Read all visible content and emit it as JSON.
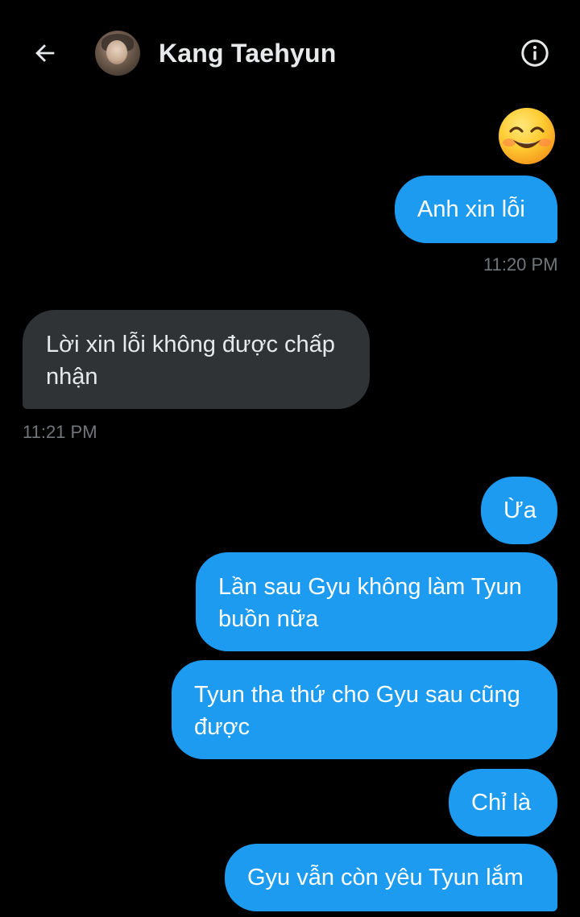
{
  "header": {
    "back_icon": "back-arrow-icon",
    "contact_name": "Kang Taehyun",
    "info_icon": "info-icon"
  },
  "colors": {
    "background": "#000000",
    "outgoing_bubble": "#1d9bf0",
    "incoming_bubble": "#2f3336",
    "timestamp": "#71767b"
  },
  "conversation": {
    "emoji_message": "smiling-face-with-smiling-eyes-emoji",
    "messages": [
      {
        "direction": "outgoing",
        "text": "Anh xin lỗi",
        "timestamp": "11:20 PM"
      },
      {
        "direction": "incoming",
        "text": "Lời xin lỗi không được chấp nhận",
        "line1": "Lời xin lỗi không được chấp",
        "line2": "nhận",
        "timestamp": "11:21 PM"
      },
      {
        "direction": "outgoing",
        "text": "Ừa"
      },
      {
        "direction": "outgoing",
        "text": "Lần sau Gyu không làm Tyun buồn nữa",
        "line1": "Lần sau Gyu không làm Tyun",
        "line2": "buồn nữa"
      },
      {
        "direction": "outgoing",
        "text": "Tyun tha thứ cho Gyu sau cũng được",
        "line1": "Tyun tha thứ cho Gyu sau cũng",
        "line2": "được"
      },
      {
        "direction": "outgoing",
        "text": "Chỉ là"
      },
      {
        "direction": "outgoing",
        "text": "Gyu vẫn còn yêu Tyun lắm"
      }
    ]
  }
}
